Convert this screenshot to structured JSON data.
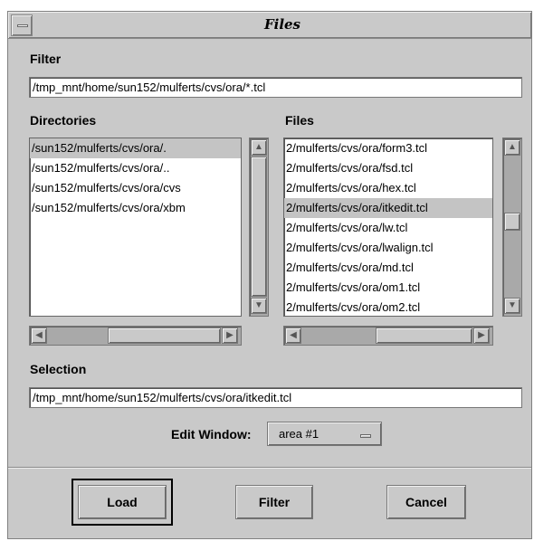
{
  "window": {
    "title": "Files"
  },
  "filter": {
    "label": "Filter",
    "value": "/tmp_mnt/home/sun152/mulferts/cvs/ora/*.tcl"
  },
  "directories": {
    "label": "Directories",
    "items": [
      {
        "text": "/sun152/mulferts/cvs/ora/.",
        "selected": true
      },
      {
        "text": "/sun152/mulferts/cvs/ora/..",
        "selected": false
      },
      {
        "text": "/sun152/mulferts/cvs/ora/cvs",
        "selected": false
      },
      {
        "text": "/sun152/mulferts/cvs/ora/xbm",
        "selected": false
      }
    ]
  },
  "files": {
    "label": "Files",
    "items": [
      {
        "text": "2/mulferts/cvs/ora/form3.tcl",
        "selected": false
      },
      {
        "text": "2/mulferts/cvs/ora/fsd.tcl",
        "selected": false
      },
      {
        "text": "2/mulferts/cvs/ora/hex.tcl",
        "selected": false
      },
      {
        "text": "2/mulferts/cvs/ora/itkedit.tcl",
        "selected": true
      },
      {
        "text": "2/mulferts/cvs/ora/lw.tcl",
        "selected": false
      },
      {
        "text": "2/mulferts/cvs/ora/lwalign.tcl",
        "selected": false
      },
      {
        "text": "2/mulferts/cvs/ora/md.tcl",
        "selected": false
      },
      {
        "text": "2/mulferts/cvs/ora/om1.tcl",
        "selected": false
      },
      {
        "text": "2/mulferts/cvs/ora/om2.tcl",
        "selected": false
      }
    ]
  },
  "selection": {
    "label": "Selection",
    "value": "/tmp_mnt/home/sun152/mulferts/cvs/ora/itkedit.tcl"
  },
  "edit_window": {
    "label": "Edit Window:",
    "value": "area #1"
  },
  "buttons": {
    "load": "Load",
    "filter": "Filter",
    "cancel": "Cancel"
  },
  "icons": {
    "window_menu": "window-menu-icon",
    "up": "arrow-up-icon",
    "down": "arrow-down-icon",
    "left": "arrow-left-icon",
    "right": "arrow-right-icon",
    "option": "option-menu-indicator-icon"
  }
}
